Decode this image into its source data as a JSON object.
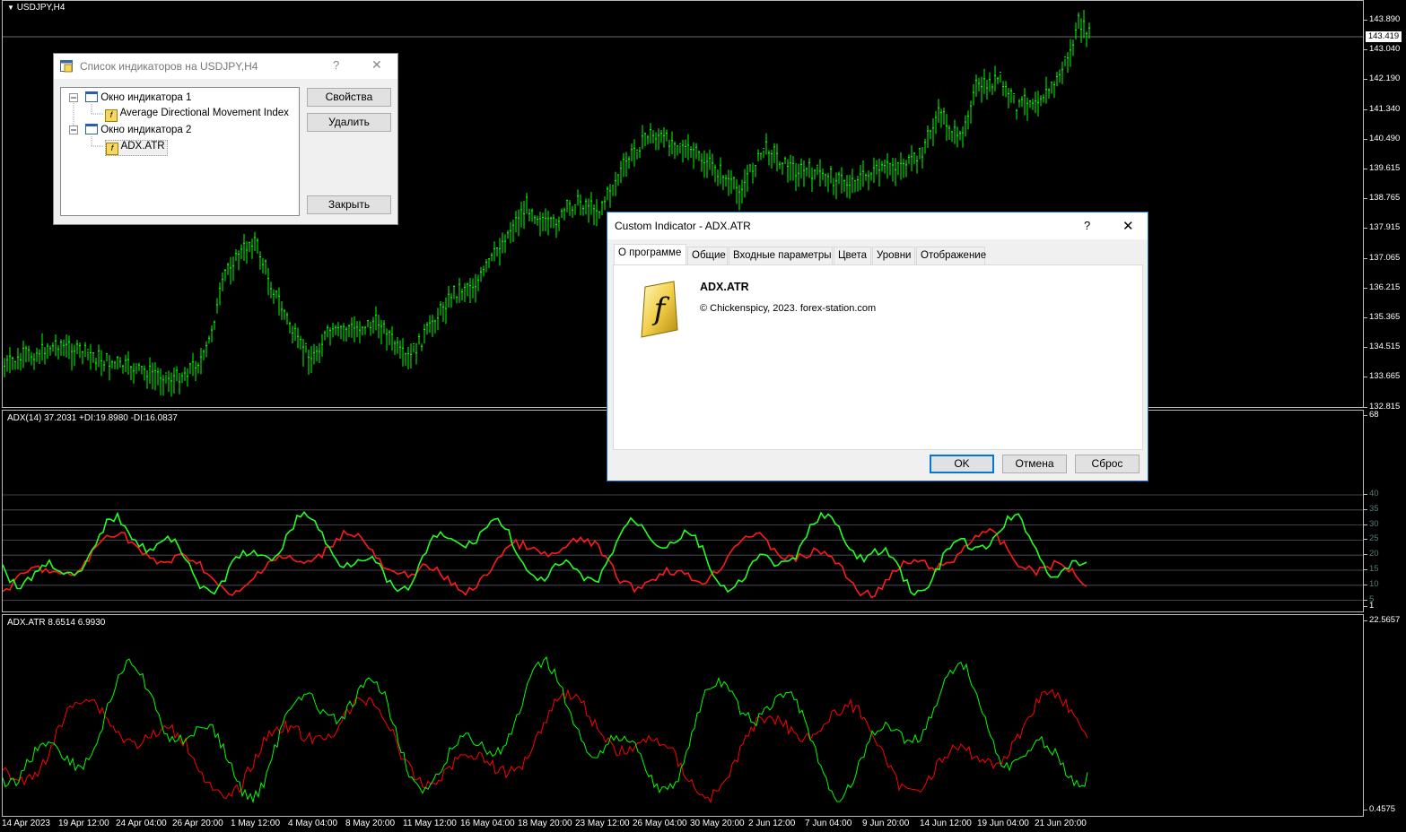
{
  "main_chart": {
    "symbol_label": "USDJPY,H4",
    "current_price": "143.419",
    "price_ticks": [
      "143.890",
      "143.040",
      "142.190",
      "141.340",
      "140.490",
      "139.615",
      "138.765",
      "137.915",
      "137.065",
      "136.215",
      "135.365",
      "134.515",
      "133.665",
      "132.815"
    ],
    "bull_color": "#00ff00"
  },
  "adx_pane": {
    "label": "ADX(14) 37.2031 +DI:19.8980 -DI:16.0837",
    "top_value": "68",
    "bottom_value": "1",
    "level_labels": [
      "40",
      "35",
      "30",
      "25",
      "20",
      "15",
      "10",
      "5"
    ]
  },
  "atr_pane": {
    "label": "ADX.ATR 8.6514 6.9930",
    "top_value": "22.5657",
    "bottom_value": "0.4575",
    "colors": {
      "up": "#00ff00",
      "down": "#ff0000"
    }
  },
  "time_axis": [
    "14 Apr 2023",
    "19 Apr 12:00",
    "24 Apr 04:00",
    "26 Apr 20:00",
    "1 May 12:00",
    "4 May 04:00",
    "8 May 20:00",
    "11 May 12:00",
    "16 May 04:00",
    "18 May 20:00",
    "23 May 12:00",
    "26 May 04:00",
    "30 May 20:00",
    "2 Jun 12:00",
    "7 Jun 04:00",
    "9 Jun 20:00",
    "14 Jun 12:00",
    "19 Jun 04:00",
    "21 Jun 20:00"
  ],
  "indicator_list_dialog": {
    "title": "Список индикаторов на USDJPY,H4",
    "help": "?",
    "close": "✕",
    "tree": [
      {
        "label": "Окно индикатора 1",
        "icon": "window-icon"
      },
      {
        "label": "Average Directional Movement Index",
        "icon": "function-icon"
      },
      {
        "label": "Окно индикатора 2",
        "icon": "window-icon"
      },
      {
        "label": "ADX.ATR",
        "icon": "custom-function-icon"
      }
    ],
    "buttons": {
      "properties": "Свойства",
      "delete": "Удалить",
      "close": "Закрыть"
    }
  },
  "custom_indicator_dialog": {
    "title": "Custom Indicator - ADX.ATR",
    "help": "?",
    "close": "✕",
    "tabs": [
      "О программе",
      "Общие",
      "Входные параметры",
      "Цвета",
      "Уровни",
      "Отображение"
    ],
    "active_tab": "О программе",
    "indicator_name": "ADX.ATR",
    "copyright": "© Chickenspicy, 2023. forex-station.com",
    "logo_glyph": "f",
    "buttons": {
      "ok": "OK",
      "cancel": "Отмена",
      "reset": "Сброс"
    }
  }
}
